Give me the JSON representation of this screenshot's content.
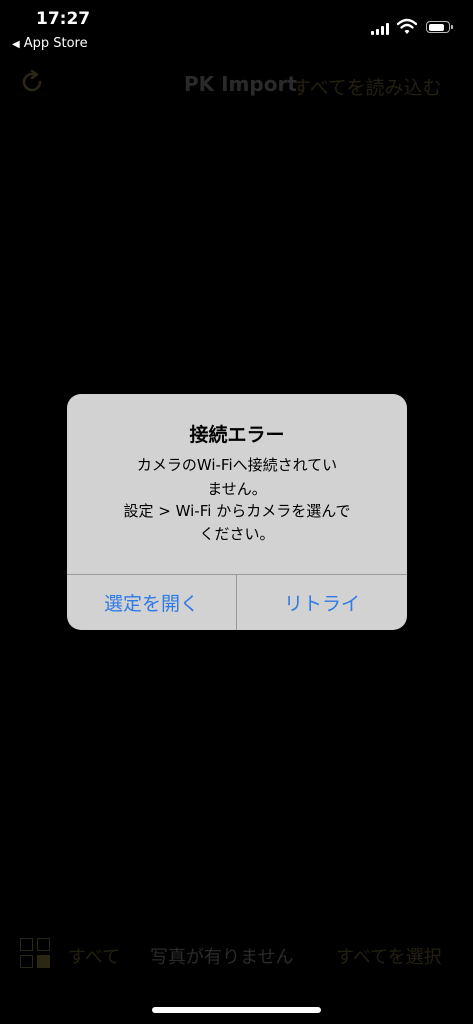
{
  "status_bar": {
    "time": "17:27",
    "back_app_label": "App Store",
    "icons": [
      "cellular-signal-icon",
      "wifi-icon",
      "battery-icon"
    ],
    "battery_level": 0.85
  },
  "nav_bar": {
    "icon": "refresh-icon",
    "title": "PK Import",
    "right_action": "すべてを読み込む"
  },
  "bottom_bar": {
    "icon": "grid-select-icon",
    "all_label": "すべて",
    "empty_label": "写真が有りません",
    "select_all_label": "すべてを選択"
  },
  "alert": {
    "title": "接続エラー",
    "message_lines": [
      "カメラのWi-Fiへ接続されてい",
      "ません。",
      "設定 > Wi-Fi からカメラを選んで",
      "ください。"
    ],
    "buttons": {
      "open_settings": "選定を開く",
      "retry": "リトライ"
    }
  },
  "colors": {
    "background": "#000000",
    "alert_background": "#d2d2d2",
    "alert_button": "#2f7be6",
    "dimmed_accent": "#2c2714"
  }
}
